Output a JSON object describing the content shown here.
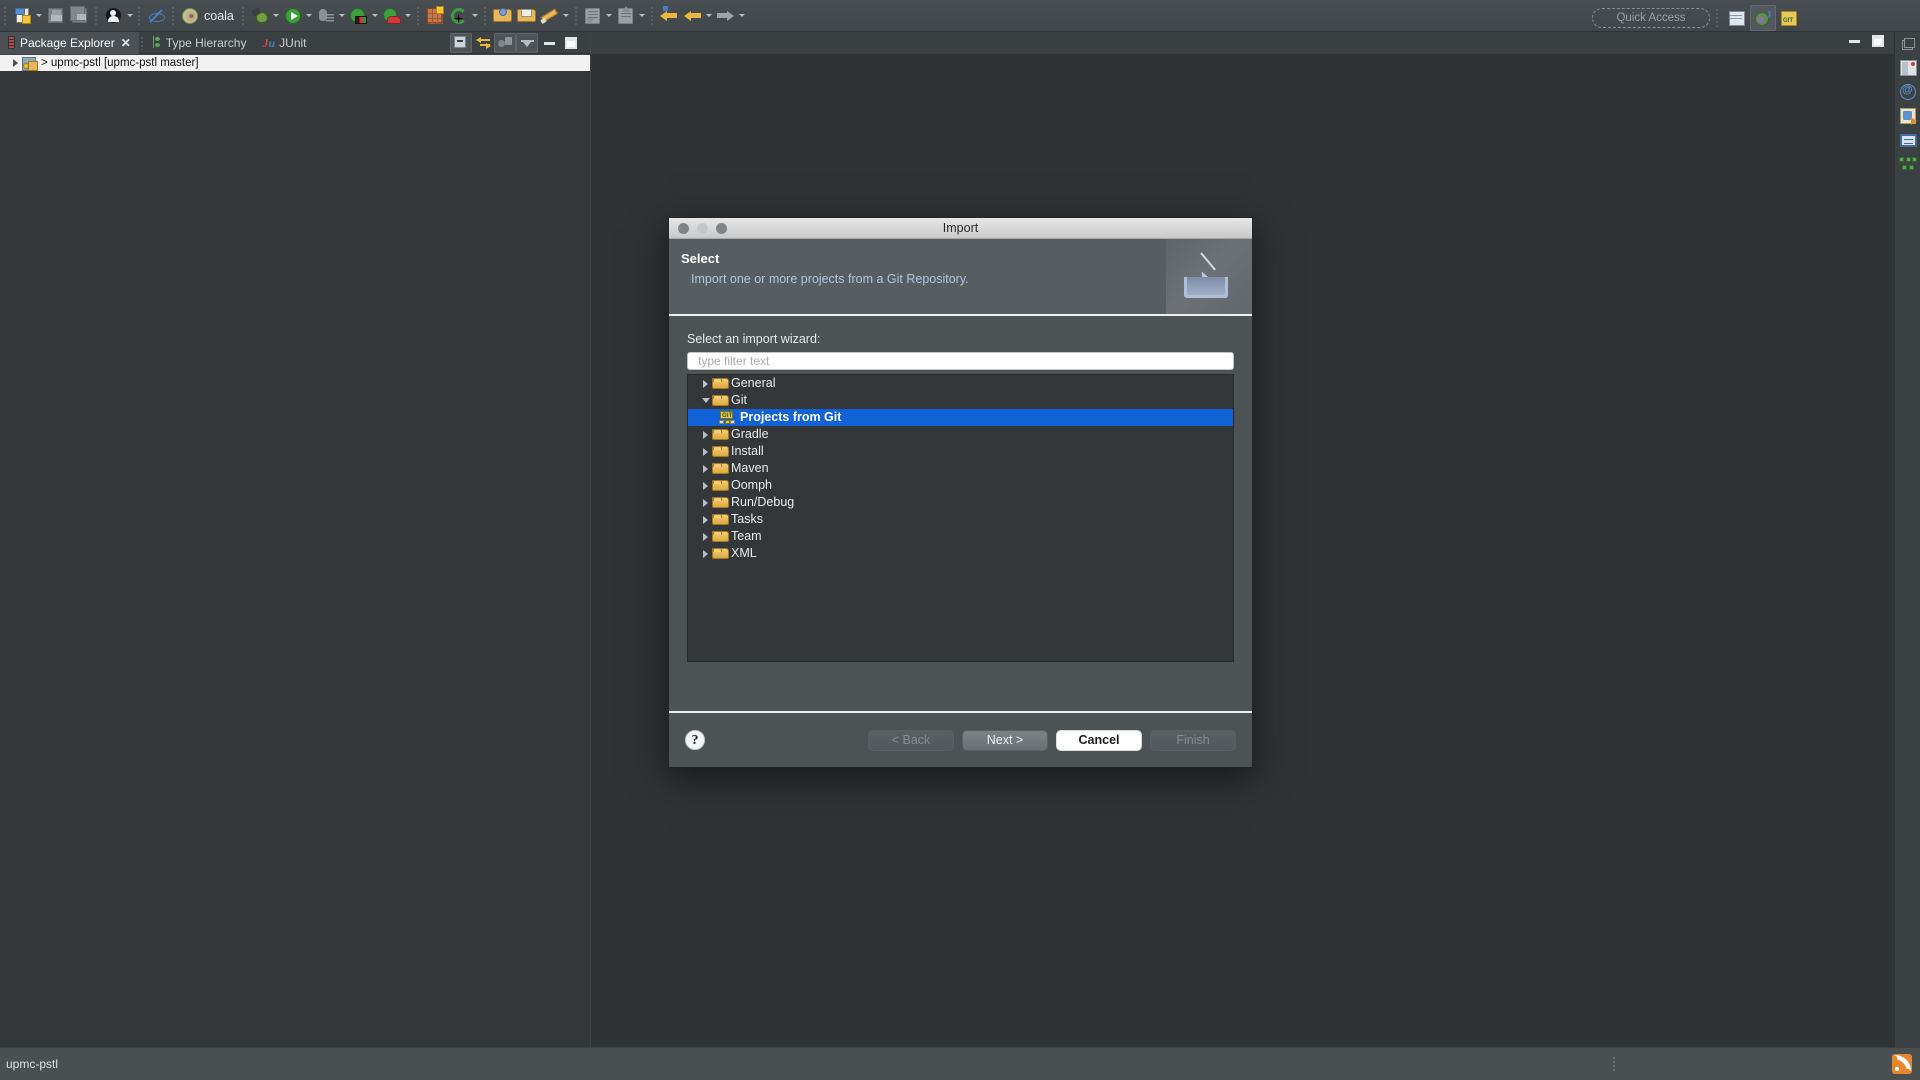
{
  "app": {
    "status_text": "upmc-pstl",
    "quick_access_placeholder": "Quick Access"
  },
  "toolbar": {
    "coala_label": "coala",
    "groups": [
      {
        "items": [
          {
            "name": "new-wizard-icon",
            "label": "New",
            "has_dropdown": true
          },
          {
            "name": "save-icon",
            "label": "Save",
            "has_dropdown": false
          },
          {
            "name": "save-all-icon",
            "label": "Save All",
            "has_dropdown": false
          }
        ]
      },
      {
        "items": [
          {
            "name": "person-icon",
            "label": "Open Task",
            "has_dropdown": true
          }
        ]
      },
      {
        "items": [
          {
            "name": "no-eye-icon",
            "label": "Deactivate Task",
            "has_dropdown": false
          }
        ]
      },
      {
        "items": [
          {
            "name": "coala-icon",
            "label": "coala",
            "has_dropdown": false
          }
        ]
      },
      {
        "items": [
          {
            "name": "debug-bug-icon",
            "label": "Debug",
            "has_dropdown": true
          },
          {
            "name": "run-icon",
            "label": "Run",
            "has_dropdown": true
          },
          {
            "name": "external-tools-icon",
            "label": "External Tools",
            "has_dropdown": true
          },
          {
            "name": "coverage-icon",
            "label": "Coverage",
            "has_dropdown": true
          },
          {
            "name": "run-car-icon",
            "label": "Run Configurations",
            "has_dropdown": true
          }
        ]
      },
      {
        "items": [
          {
            "name": "new-package-icon",
            "label": "New Java Package",
            "has_dropdown": false
          },
          {
            "name": "new-class-icon",
            "label": "New Java Class",
            "has_dropdown": true
          }
        ]
      },
      {
        "items": [
          {
            "name": "open-type-icon",
            "label": "Open Type",
            "has_dropdown": false
          },
          {
            "name": "search-folder-icon",
            "label": "Search",
            "has_dropdown": false
          },
          {
            "name": "annotate-icon",
            "label": "Annotate",
            "has_dropdown": true
          }
        ]
      },
      {
        "items": [
          {
            "name": "import-wizard-icon",
            "label": "Import",
            "has_dropdown": true
          },
          {
            "name": "export-wizard-icon",
            "label": "Export",
            "has_dropdown": true
          }
        ]
      },
      {
        "items": [
          {
            "name": "back-pinned-arrow-icon",
            "label": "Back",
            "has_dropdown": false
          },
          {
            "name": "back-arrow-icon",
            "label": "Back",
            "has_dropdown": true
          },
          {
            "name": "forward-arrow-icon",
            "label": "Forward",
            "has_dropdown": true
          }
        ]
      }
    ],
    "perspectives": [
      {
        "name": "open-perspective-icon",
        "label": "Open Perspective",
        "active": false
      },
      {
        "name": "java-perspective-icon",
        "label": "Java",
        "active": true
      },
      {
        "name": "git-perspective-icon",
        "label": "Git",
        "active": false
      }
    ]
  },
  "left_view": {
    "tabs": [
      {
        "label": "Package Explorer",
        "icon": "package-explorer-icon",
        "active": true,
        "closable": true
      },
      {
        "label": "Type Hierarchy",
        "icon": "type-hierarchy-icon",
        "active": false,
        "closable": false
      },
      {
        "label": "JUnit",
        "icon": "junit-icon",
        "active": false,
        "closable": false
      }
    ],
    "tools": [
      {
        "name": "collapse-all-button",
        "label": "Collapse All"
      },
      {
        "name": "link-with-editor-button",
        "label": "Link with Editor"
      },
      {
        "name": "focus-on-active-task-button",
        "label": "Focus on Active Task"
      },
      {
        "name": "view-menu-button",
        "label": "View Menu"
      },
      {
        "name": "minimize-view-button",
        "label": "Minimize"
      },
      {
        "name": "maximize-view-button",
        "label": "Maximize"
      }
    ],
    "project": {
      "label": "> upmc-pstl  [upmc-pstl master]",
      "expandable": true
    }
  },
  "right_bar": {
    "items": [
      {
        "name": "restore-icon",
        "label": "Restore"
      },
      {
        "name": "servers-icon",
        "label": "Servers"
      },
      {
        "name": "at-sign-icon",
        "label": "Mylyn"
      },
      {
        "name": "task-list-icon",
        "label": "Task List"
      },
      {
        "name": "console-icon",
        "label": "Console"
      },
      {
        "name": "hierarchy-icon",
        "label": "Hierarchy"
      }
    ]
  },
  "dialog": {
    "title": "Import",
    "traffic_lights": [
      {
        "name": "close-window-button",
        "label": "Close"
      },
      {
        "name": "minimize-window-button",
        "label": "Minimize"
      },
      {
        "name": "zoom-window-button",
        "label": "Zoom"
      }
    ],
    "banner": {
      "heading": "Select",
      "description": "Import one or more projects from a Git Repository.",
      "icon": "import-tray-arrow-icon"
    },
    "wizard_label": "Select an import wizard:",
    "filter_placeholder": "type filter text",
    "filter_value": "",
    "tree": [
      {
        "label": "General",
        "icon": "folder-icon",
        "state": "collapsed",
        "indent": 0,
        "selected": false
      },
      {
        "label": "Git",
        "icon": "folder-icon",
        "state": "expanded",
        "indent": 0,
        "selected": false
      },
      {
        "label": "Projects from Git",
        "icon": "git-wizard-icon",
        "state": "leaf",
        "indent": 1,
        "selected": true
      },
      {
        "label": "Gradle",
        "icon": "folder-icon",
        "state": "collapsed",
        "indent": 0,
        "selected": false
      },
      {
        "label": "Install",
        "icon": "folder-icon",
        "state": "collapsed",
        "indent": 0,
        "selected": false
      },
      {
        "label": "Maven",
        "icon": "folder-icon",
        "state": "collapsed",
        "indent": 0,
        "selected": false
      },
      {
        "label": "Oomph",
        "icon": "folder-icon",
        "state": "collapsed",
        "indent": 0,
        "selected": false
      },
      {
        "label": "Run/Debug",
        "icon": "folder-icon",
        "state": "collapsed",
        "indent": 0,
        "selected": false
      },
      {
        "label": "Tasks",
        "icon": "folder-icon",
        "state": "collapsed",
        "indent": 0,
        "selected": false
      },
      {
        "label": "Team",
        "icon": "folder-icon",
        "state": "collapsed",
        "indent": 0,
        "selected": false
      },
      {
        "label": "XML",
        "icon": "folder-icon",
        "state": "collapsed",
        "indent": 0,
        "selected": false
      }
    ],
    "help_label": "?",
    "buttons": [
      {
        "label": "< Back",
        "name": "back-button",
        "state": "disabled"
      },
      {
        "label": "Next >",
        "name": "next-button",
        "state": "enabled"
      },
      {
        "label": "Cancel",
        "name": "cancel-button",
        "state": "default"
      },
      {
        "label": "Finish",
        "name": "finish-button",
        "state": "disabled"
      }
    ]
  },
  "colors": {
    "selection_blue": "#1062d6",
    "banner_link": "#aec6e0",
    "folder_yellow": "#dfa93c",
    "accent_orange": "#e8862e"
  }
}
